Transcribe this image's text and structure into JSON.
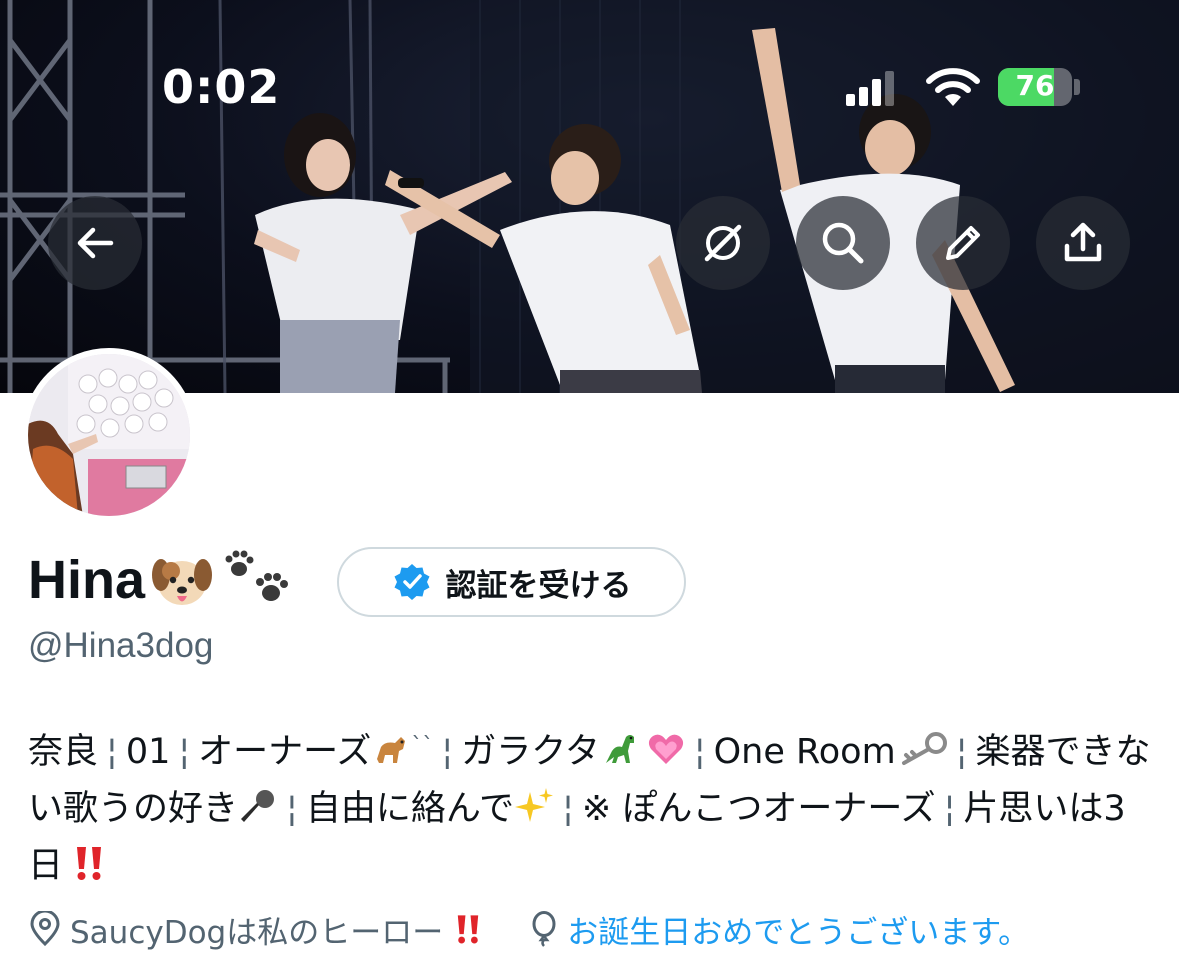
{
  "status_bar": {
    "time": "0:02",
    "battery_percent": "76",
    "battery_level": 0.76,
    "signal_bars_active": 3
  },
  "header_actions": [
    {
      "name": "back",
      "icon": "arrow-left-icon"
    },
    {
      "name": "grok",
      "icon": "grok-icon"
    },
    {
      "name": "search",
      "icon": "search-icon"
    },
    {
      "name": "edit",
      "icon": "pencil-icon"
    },
    {
      "name": "share",
      "icon": "share-icon"
    }
  ],
  "profile": {
    "display_name": "Hina",
    "name_emojis": [
      "dog-face-emoji",
      "paw-prints-emoji"
    ],
    "handle": "@Hina3dog",
    "verify_button": {
      "label": "認証を受ける",
      "icon": "verified-badge-icon"
    },
    "bio": {
      "segments": [
        "奈良",
        "01",
        "オーナーズ",
        "ガラクタ",
        "One Room",
        "楽器できない歌うの好き",
        "自由に絡んで",
        "※ ぽんこつオーナーズ",
        "片思いは3日"
      ],
      "separator": "¦",
      "emojis": {
        "after_owners": "dog-emoji",
        "after_garakuta": "dinosaur-emoji",
        "after_garakuta_2": "pink-heart-emoji",
        "after_one_room": "key-emoji",
        "after_sing": "microphone-emoji",
        "after_free": "sparkles-emoji",
        "after_3days": "double-exclamation-emoji"
      },
      "mark_after_dog": "``"
    },
    "location": {
      "text": "SaucyDogは私のヒーロー",
      "icon": "location-pin-icon",
      "trailing_emoji": "double-exclamation-emoji"
    },
    "birthday": {
      "text": "お誕生日おめでとうございます。",
      "icon": "balloon-icon"
    }
  },
  "colors": {
    "link": "#1d9bf0",
    "secondary_text": "#536471",
    "verified_blue": "#1d9bf0",
    "battery_green": "#4cd964"
  }
}
